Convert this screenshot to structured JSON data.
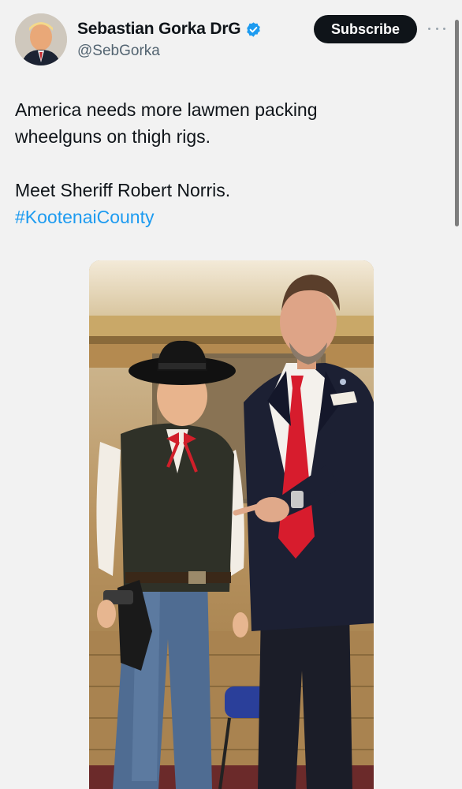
{
  "author": {
    "display_name": "Sebastian Gorka DrG",
    "handle": "@SebGorka",
    "verified": true
  },
  "actions": {
    "subscribe_label": "Subscribe",
    "more_icon": "more-dots-icon"
  },
  "tweet": {
    "line1": "America needs more lawmen packing",
    "line2": "wheelguns on thigh rigs.",
    "line3": "Meet Sheriff Robert Norris.",
    "hashtag": "#KootenaiCounty"
  },
  "colors": {
    "accent": "#1d9bf0",
    "text": "#0f1419",
    "muted": "#536471",
    "background": "#f2f2f2"
  }
}
